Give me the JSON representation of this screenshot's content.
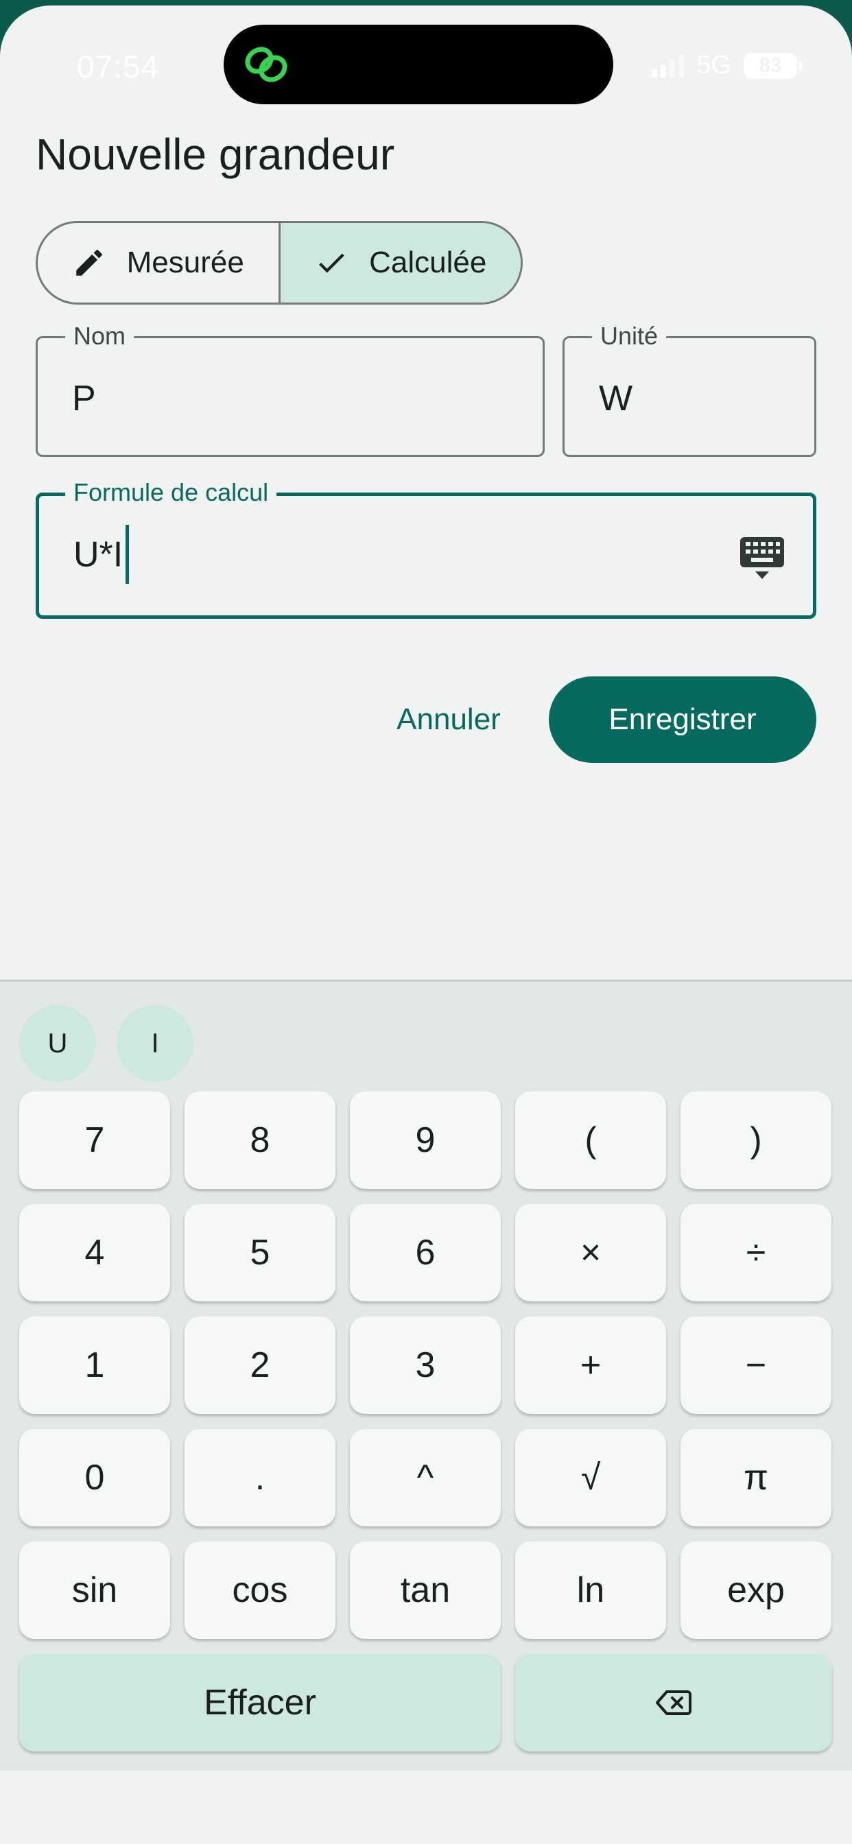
{
  "status_bar": {
    "time": "07:54",
    "network": "5G",
    "battery": "83"
  },
  "dialog": {
    "title": "Nouvelle grandeur",
    "segments": [
      {
        "label": "Mesurée",
        "icon": "pencil-icon",
        "selected": false
      },
      {
        "label": "Calculée",
        "icon": "check-icon",
        "selected": true
      }
    ],
    "name_field": {
      "label": "Nom",
      "value": "P"
    },
    "unit_field": {
      "label": "Unité",
      "value": "W"
    },
    "formula_field": {
      "label": "Formule de calcul",
      "value": "U*I"
    },
    "cancel_label": "Annuler",
    "save_label": "Enregistrer"
  },
  "keypad": {
    "variables": [
      "U",
      "I"
    ],
    "rows": [
      [
        "7",
        "8",
        "9",
        "(",
        ")"
      ],
      [
        "4",
        "5",
        "6",
        "×",
        "÷"
      ],
      [
        "1",
        "2",
        "3",
        "+",
        "−"
      ],
      [
        "0",
        ".",
        "^",
        "√",
        "π"
      ],
      [
        "sin",
        "cos",
        "tan",
        "ln",
        "exp"
      ]
    ],
    "clear_label": "Effacer",
    "backspace_icon": "backspace-icon"
  },
  "colors": {
    "primary": "#066b5e",
    "secondary_container": "#cde8e1",
    "background": "#f0f3f2"
  }
}
